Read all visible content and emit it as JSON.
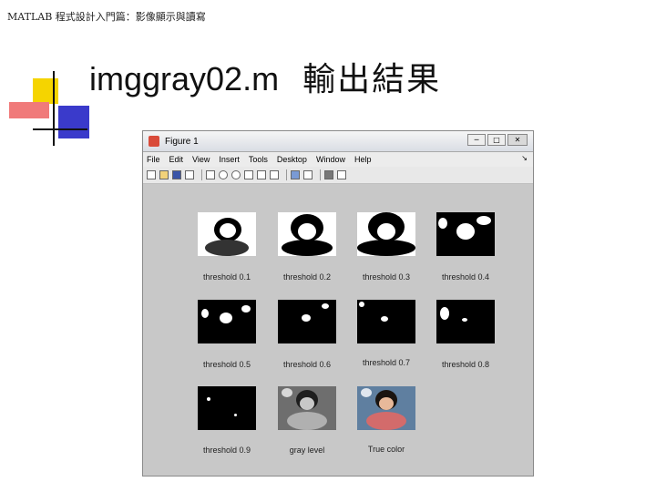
{
  "header": {
    "text": "MATLAB 程式設計入門篇：影像顯示與讀寫"
  },
  "slide": {
    "title_en": "imggray02.m",
    "title_zh": "輸出結果"
  },
  "figure": {
    "title": "Figure 1",
    "window_buttons": [
      "─",
      "□",
      "✕"
    ],
    "menu": [
      "File",
      "Edit",
      "View",
      "Insert",
      "Tools",
      "Desktop",
      "Window",
      "Help"
    ],
    "menu_arrow": "↘",
    "toolbar_icons": [
      "new-file-icon",
      "open-folder-icon",
      "save-icon",
      "print-icon",
      "pointer-icon",
      "zoom-in-icon",
      "zoom-out-icon",
      "pan-icon",
      "rotate-icon",
      "data-cursor-icon",
      "colorbar-icon",
      "legend-icon",
      "hide-plot-tools-icon",
      "show-plot-tools-icon"
    ],
    "captions": [
      "threshold 0.1",
      "threshold 0.2",
      "threshold 0.3",
      "threshold 0.4",
      "threshold 0.5",
      "threshold 0.6",
      "threshold 0.7",
      "threshold 0.8",
      "threshold 0.9",
      "gray level",
      "True color"
    ]
  },
  "colors": {
    "deco_yellow": "#f5d400",
    "deco_red": "#f07a7a",
    "deco_blue": "#3a3acb",
    "figure_bg": "#c8c8c8"
  }
}
